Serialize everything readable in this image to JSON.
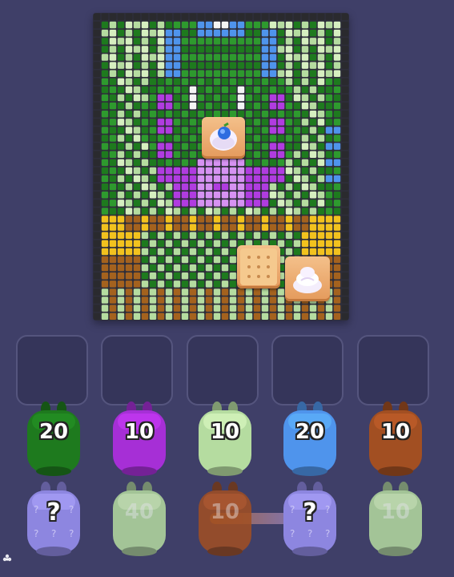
{
  "puzzle": {
    "items": [
      {
        "name": "blueberry-cream-tile"
      },
      {
        "name": "cracker-tile"
      },
      {
        "name": "cream-tile"
      }
    ]
  },
  "queue": {
    "slots_total": 5,
    "slots_filled": 0
  },
  "bunnies": {
    "row1": [
      {
        "color": "#1e7a1e",
        "count": "20"
      },
      {
        "color": "#a62fd6",
        "count": "10"
      },
      {
        "color": "#b5dca0",
        "count": "10"
      },
      {
        "color": "#4f94ec",
        "count": "20"
      },
      {
        "color": "#a24f22",
        "count": "10"
      }
    ],
    "row2": [
      {
        "color": "#8d86e0",
        "count": "?",
        "mystery": true
      },
      {
        "color": "#b5dca0",
        "count": "40"
      },
      {
        "color": "#a24f22",
        "count": "10"
      },
      {
        "color": "#8d86e0",
        "count": "?",
        "mystery": true
      },
      {
        "color": "#b5dca0",
        "count": "10"
      }
    ]
  },
  "icons": {
    "corner": "flower-icon"
  }
}
